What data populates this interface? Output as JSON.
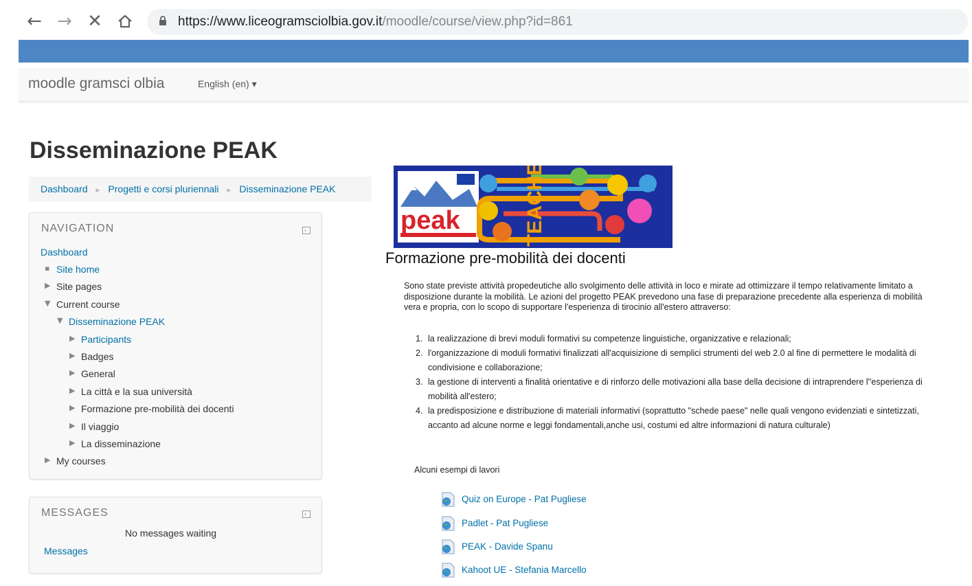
{
  "browser": {
    "url_host": "https://www.liceogramsciolbia.gov.it",
    "url_path": "/moodle/course/view.php?id=861"
  },
  "navbar": {
    "brand": "moodle gramsci olbia",
    "language": "English (en) ▾"
  },
  "page": {
    "title": "Disseminazione PEAK",
    "breadcrumb": [
      "Dashboard",
      "Progetti e corsi pluriennali",
      "Disseminazione PEAK"
    ]
  },
  "navigation_block": {
    "title": "NAVIGATION",
    "dashboard": "Dashboard",
    "site_home": "Site home",
    "site_pages": "Site pages",
    "current_course": "Current course",
    "course_name": "Disseminazione PEAK",
    "sections": [
      "Participants",
      "Badges",
      "General",
      "La città e la sua università",
      "Formazione pre-mobilità dei docenti",
      "Il viaggio",
      "La disseminazione"
    ],
    "my_courses": "My courses"
  },
  "messages_block": {
    "title": "MESSAGES",
    "empty_text": "No messages waiting",
    "link": "Messages"
  },
  "banner": {
    "logo_text": "peak",
    "vertical_text": "TEACHER"
  },
  "main": {
    "section_title": "Formazione pre-mobilità dei docenti",
    "intro": "Sono state previste attività propedeutiche allo svolgimento delle attività in loco e mirate ad ottimizzare il tempo relativamente limitato a disposizione durante la mobilità. Le azioni del progetto PEAK prevedono una fase di preparazione precedente alla esperienza di mobilità vera e propria, con lo scopo di supportare l'esperienza di tirocinio all'estero attraverso:",
    "list": [
      "la realizzazione di brevi moduli formativi su competenze linguistiche, organizzative e relazionali;",
      "l'organizzazione di moduli formativi finalizzati all'acquisizione di semplici strumenti del web 2.0 al fine di permettere le modalità di condivisione e collaborazione;",
      "la gestione di interventi a finalità orientative e di rinforzo delle motivazioni alla base della decisione di intraprendere l''esperienza di mobilità all'estero;",
      "la predisposizione e distribuzione di materiali informativi (soprattutto \"schede paese\" nelle quali vengono evidenziati e sintetizzati, accanto ad alcune norme e leggi fondamentali,anche usi, costumi ed altre informazioni di natura culturale)"
    ],
    "examples_label": "Alcuni esempi di lavori",
    "resources": [
      "Quiz on Europe - Pat Pugliese",
      "Padlet - Pat Pugliese",
      "PEAK - Davide Spanu",
      "Kahoot UE - Stefania Marcello"
    ]
  },
  "colors": {
    "blue_band": "#4d86c5",
    "link": "#0070a8",
    "banner_bg": "#1c2f9e"
  }
}
